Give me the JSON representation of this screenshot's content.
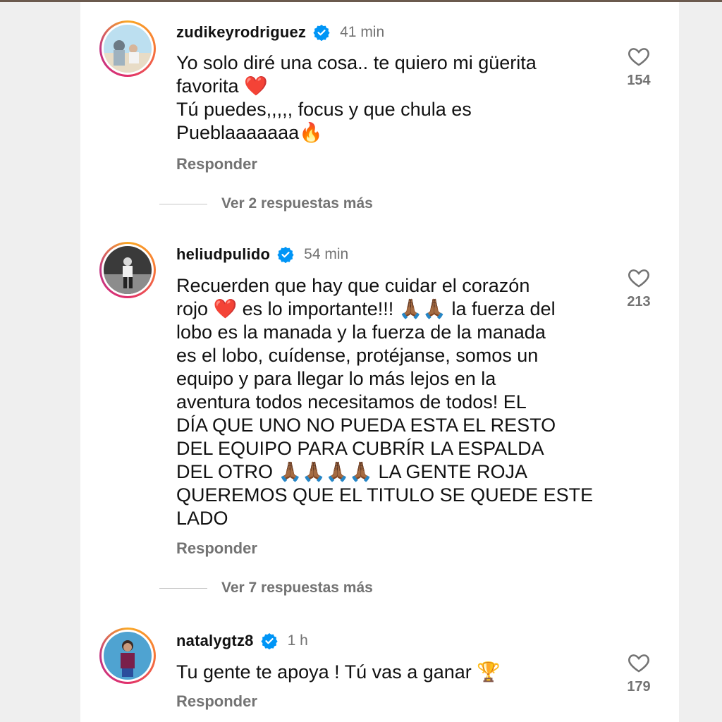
{
  "comments": [
    {
      "username": "zudikeyrodriguez",
      "time": "41 min",
      "lines": [
        "Yo solo diré una cosa.. te quiero mi güerita",
        "favorita ❤️",
        "Tú puedes,,,,, focus y que chula es",
        "Pueblaaaaaaa🔥"
      ],
      "reply_label": "Responder",
      "likes": "154",
      "more_replies": "Ver 2 respuestas más"
    },
    {
      "username": "heliudpulido",
      "time": "54 min",
      "lines": [
        "Recuerden que hay que cuidar el corazón",
        "rojo ❤️ es lo importante!!! 🙏🏾🙏🏾 la fuerza del",
        "lobo es la manada y la fuerza de la manada",
        "es el lobo, cuídense, protéjanse, somos un",
        "equipo y para llegar lo más lejos en la",
        "aventura todos necesitamos de todos! EL",
        "DÍA QUE UNO NO PUEDA ESTA EL RESTO",
        "DEL EQUIPO PARA CUBRÍR LA ESPALDA",
        "DEL OTRO 🙏🏾🙏🏾🙏🏾🙏🏾 LA GENTE ROJA",
        "QUEREMOS QUE EL TITULO SE QUEDE ESTE",
        "LADO"
      ],
      "reply_label": "Responder",
      "likes": "213",
      "more_replies": "Ver 7 respuestas más"
    },
    {
      "username": "natalygtz8",
      "time": "1 h",
      "lines": [
        "Tu gente te apoya ! Tú vas a ganar 🏆"
      ],
      "reply_label": "Responder",
      "likes": "179"
    }
  ],
  "icons": {
    "verified": "verified-badge-icon",
    "like": "heart-icon"
  },
  "colors": {
    "verified_blue": "#0095f6",
    "muted_text": "#737373",
    "primary_text": "#111111"
  }
}
